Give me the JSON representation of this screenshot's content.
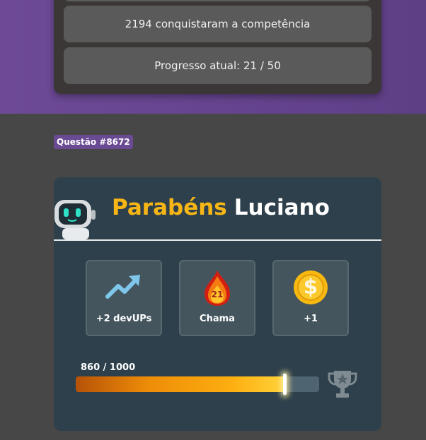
{
  "top_card": {
    "row_partial": "",
    "achievers_text": "2194 conquistaram a competência",
    "progress_text": "Progresso atual: 21 / 50"
  },
  "question_badge": "Questão #8672",
  "reward": {
    "congrats_word": "Parabéns",
    "user_name": "Luciano",
    "items": [
      {
        "icon": "trending-up-icon",
        "label": "+2 devUPs"
      },
      {
        "icon": "flame-icon",
        "label": "Chama",
        "value": "21"
      },
      {
        "icon": "coin-icon",
        "label": "+1",
        "symbol": "$"
      }
    ],
    "progress": {
      "text": "860 / 1000",
      "current": 860,
      "max": 1000
    },
    "trophy_icon": "trophy-icon"
  },
  "colors": {
    "purple_band": "#6e4a96",
    "gold_text": "#f8b616",
    "card_bg": "#2d404b",
    "page_bg": "#474747"
  }
}
